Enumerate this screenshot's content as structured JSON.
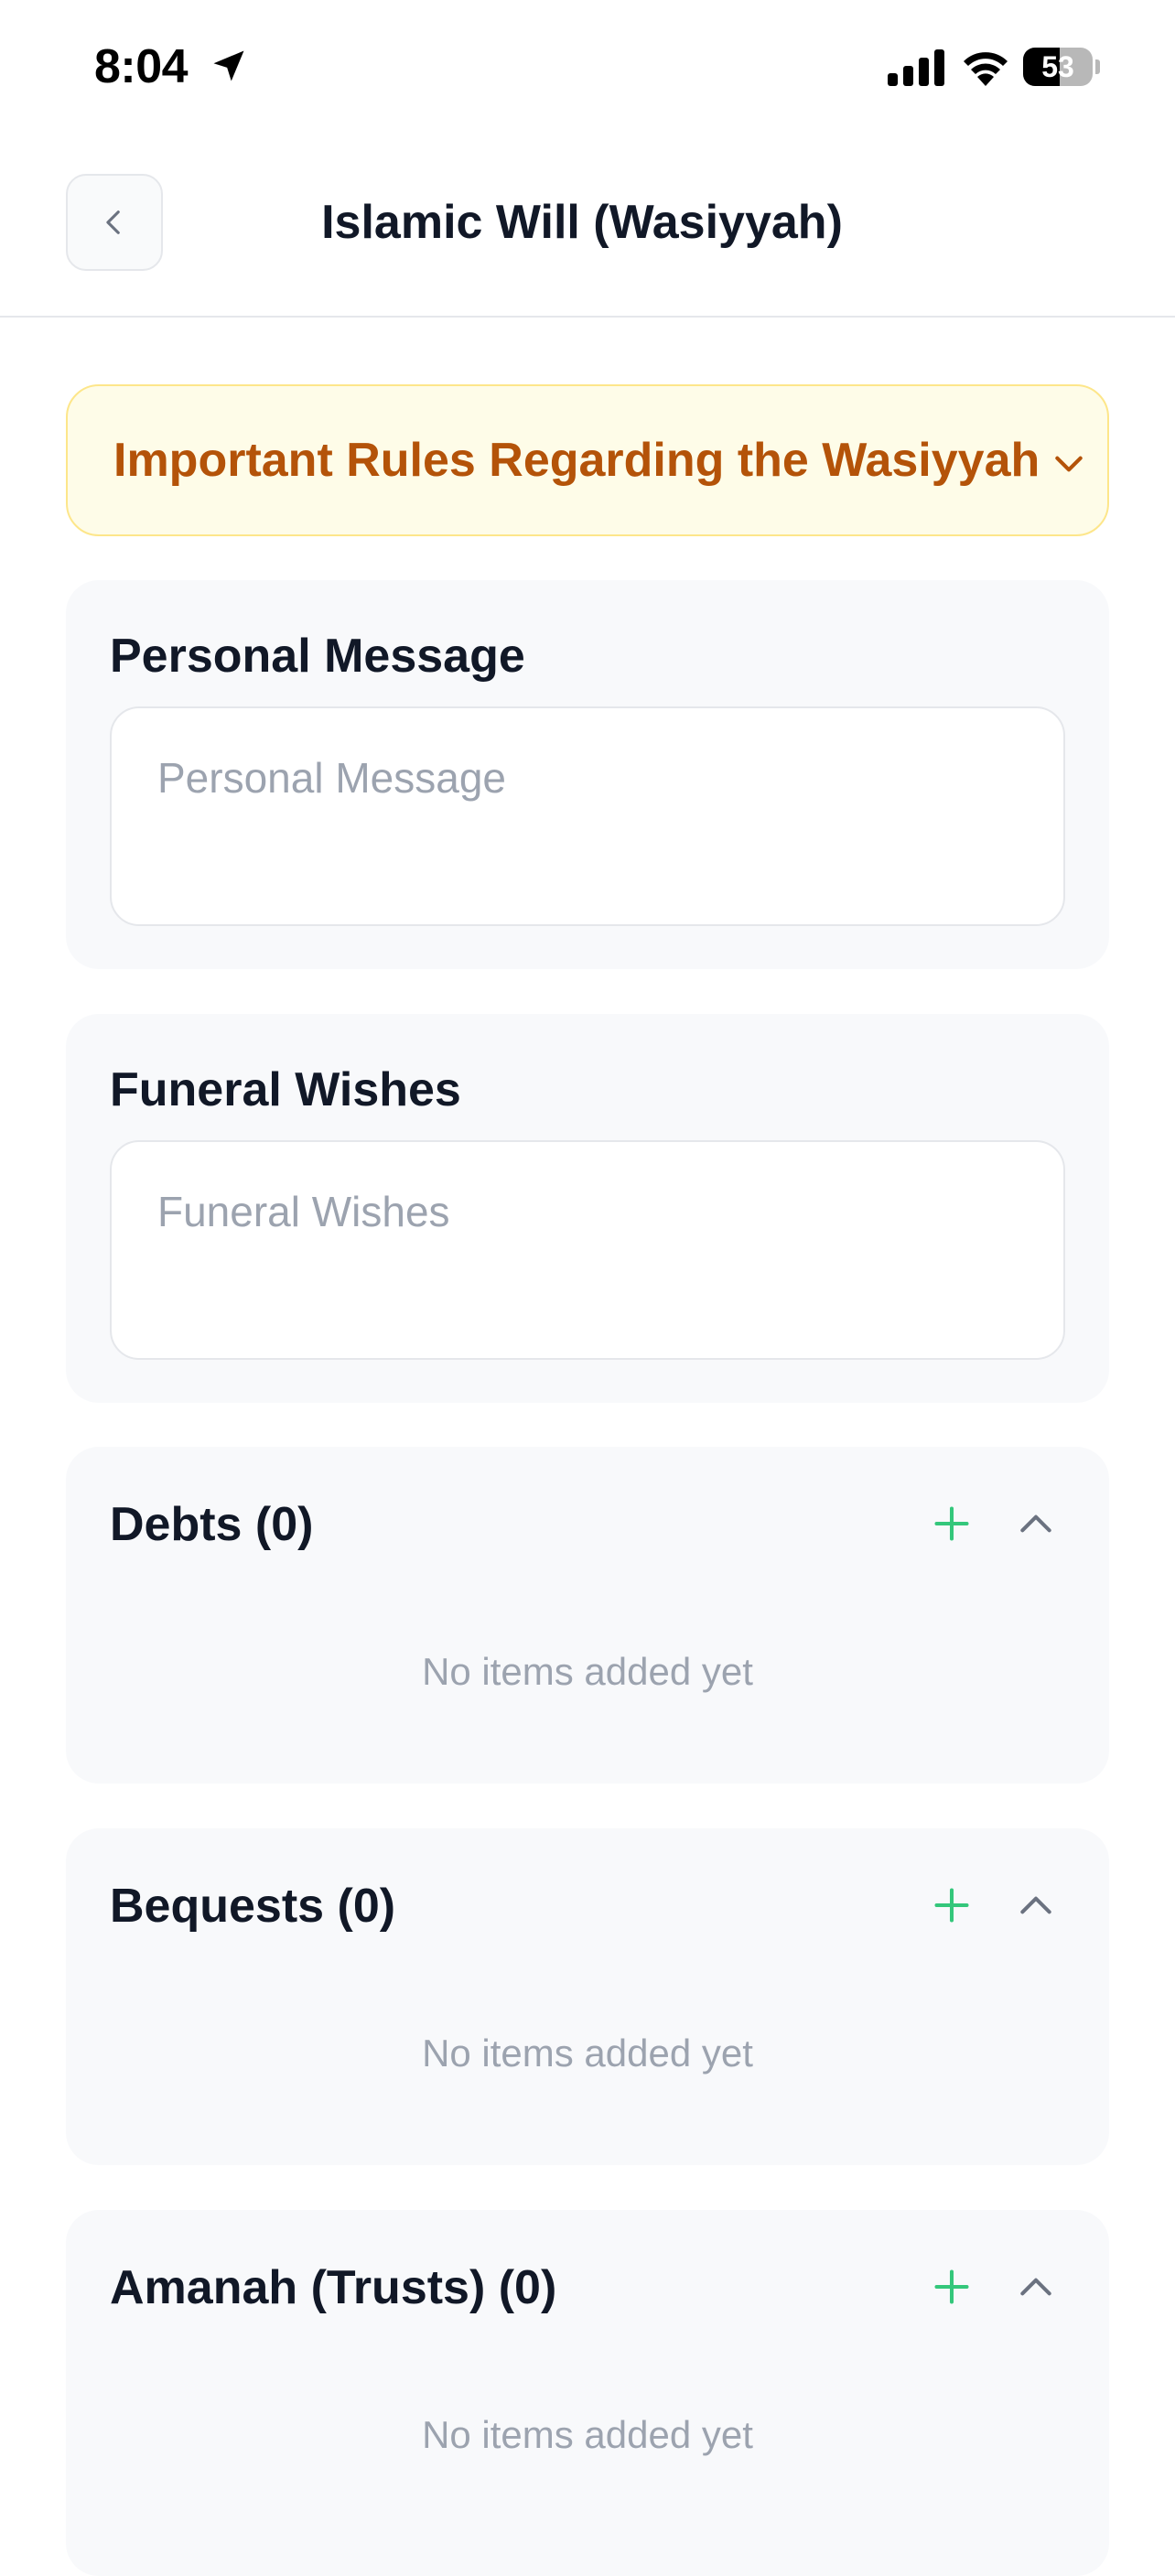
{
  "status_bar": {
    "time": "8:04",
    "battery_level": "53",
    "battery_fraction": 0.53,
    "location_icon": "location-arrow-icon",
    "signal_icon": "cellular-signal-icon",
    "wifi_icon": "wifi-icon"
  },
  "header": {
    "title": "Islamic Will (Wasiyyah)",
    "back_icon": "chevron-left-icon"
  },
  "rules_banner": {
    "title": "Important Rules Regarding the Wasiyyah",
    "icon": "chevron-down-icon"
  },
  "personal_message": {
    "label": "Personal Message",
    "placeholder": "Personal Message"
  },
  "funeral_wishes": {
    "label": "Funeral Wishes",
    "placeholder": "Funeral Wishes"
  },
  "sections": [
    {
      "title": "Debts (0)",
      "empty_text": "No items added yet"
    },
    {
      "title": "Bequests (0)",
      "empty_text": "No items added yet"
    },
    {
      "title": "Amanah (Trusts) (0)",
      "empty_text": "No items added yet"
    }
  ],
  "colors": {
    "accent_green": "#34c77b",
    "banner_text": "#b45309",
    "banner_bg": "#fefce8",
    "card_bg": "#f8f9fb"
  }
}
